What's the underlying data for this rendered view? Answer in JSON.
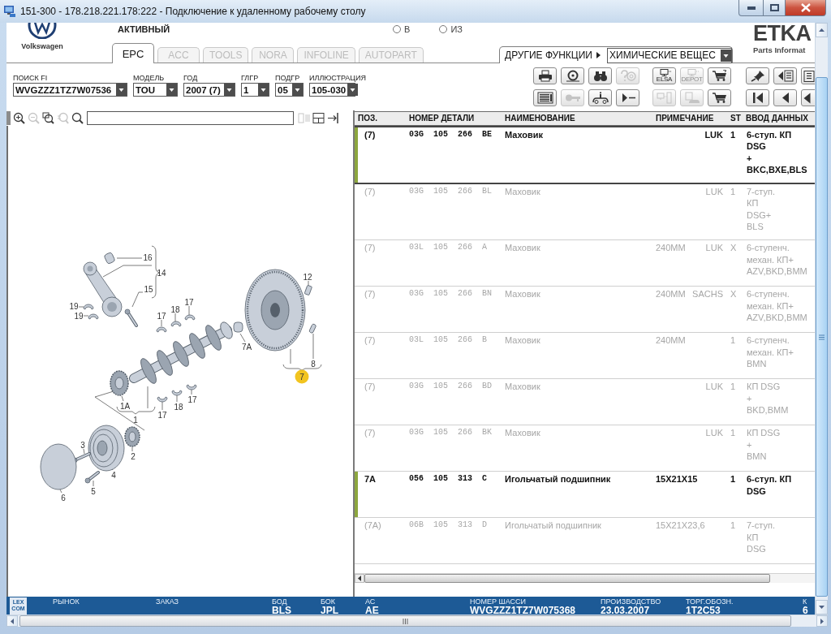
{
  "window": {
    "title": "151-300 - 178.218.221.178:222 - Подключение к удаленному рабочему столу"
  },
  "header": {
    "brand": "Volkswagen",
    "status": "АКТИВНЫЙ",
    "radios": [
      {
        "label": "В",
        "selected": false
      },
      {
        "label": "ИЗ",
        "selected": false
      }
    ],
    "logo": "ETKA",
    "logo_subtitle": "Parts Informat"
  },
  "tabs": [
    {
      "label": "EPC",
      "selected": true,
      "disabled": false
    },
    {
      "label": "ACC",
      "selected": false,
      "disabled": true
    },
    {
      "label": "TOOLS",
      "selected": false,
      "disabled": true
    },
    {
      "label": "NORA",
      "selected": false,
      "disabled": true
    },
    {
      "label": "INFOLINE",
      "selected": false,
      "disabled": true
    },
    {
      "label": "AUTOPART",
      "selected": false,
      "disabled": true
    }
  ],
  "other_functions": {
    "label": "ДРУГИЕ ФУНКЦИИ",
    "value": "ХИМИЧЕСКИЕ ВЕЩЕС"
  },
  "filters": [
    {
      "label": "ПОИСК FI",
      "value": "WVGZZZ1TZ7W07536"
    },
    {
      "label": "МОДЕЛЬ",
      "value": "TOU"
    },
    {
      "label": "ГОД",
      "value": "2007 (7)"
    },
    {
      "label": "ГЛГР",
      "value": "1"
    },
    {
      "label": "ПОДГР",
      "value": "05"
    },
    {
      "label": "ИЛЛЮСТРАЦИЯ",
      "value": "105-030"
    }
  ],
  "toolbar": {
    "rows": [
      [
        {
          "disabled": false
        },
        {
          "disabled": false
        },
        {
          "disabled": false
        },
        {
          "disabled": true
        },
        {
          "label": "ELSA",
          "disabled": false
        },
        {
          "label": "DEPOT",
          "disabled": true
        },
        {
          "disabled": false
        },
        {
          "disabled": false
        },
        {
          "disabled": false
        },
        {
          "disabled": false
        }
      ],
      [
        {
          "disabled": false
        },
        {
          "disabled": true
        },
        {
          "disabled": false
        },
        {
          "disabled": false
        },
        {
          "disabled": true
        },
        {
          "disabled": true
        },
        {
          "disabled": false
        },
        {
          "disabled": false
        },
        {
          "disabled": false
        },
        {
          "disabled": false
        }
      ]
    ]
  },
  "image_toolbar": {
    "buttons": [
      {
        "disabled": false
      },
      {
        "disabled": true
      },
      {
        "disabled": false
      },
      {
        "disabled": true
      },
      {
        "disabled": false
      },
      {
        "disabled": true
      },
      {
        "disabled": false
      },
      {
        "disabled": false
      }
    ]
  },
  "diagram": {
    "callouts": [
      {
        "label": "16",
        "selected": false
      },
      {
        "label": "14",
        "selected": false
      },
      {
        "label": "12",
        "selected": false
      },
      {
        "label": "15",
        "selected": false
      },
      {
        "label": "17",
        "selected": false
      },
      {
        "label": "19",
        "selected": false
      },
      {
        "label": "18",
        "selected": false
      },
      {
        "label": "19",
        "selected": false
      },
      {
        "label": "17",
        "selected": false
      },
      {
        "label": "7A",
        "selected": false
      },
      {
        "label": "8",
        "selected": false
      },
      {
        "label": "7",
        "selected": true
      },
      {
        "label": "17",
        "selected": false
      },
      {
        "label": "1A",
        "selected": false
      },
      {
        "label": "18",
        "selected": false
      },
      {
        "label": "17",
        "selected": false
      },
      {
        "label": "1",
        "selected": false
      },
      {
        "label": "3",
        "selected": false
      },
      {
        "label": "2",
        "selected": false
      },
      {
        "label": "4",
        "selected": false
      },
      {
        "label": "5",
        "selected": false
      },
      {
        "label": "6",
        "selected": false
      }
    ]
  },
  "table": {
    "columns": [
      "ПОЗ.",
      "НОМЕР ДЕТАЛИ",
      "НАИМЕНОВАНИЕ",
      "ПРИМЕЧАНИЕ",
      "ST",
      "ВВОД ДАННЫХ"
    ],
    "rows": [
      {
        "position": "(7)",
        "part_number": "03G 105 266 BE",
        "name": "Маховик",
        "manufacturer": "LUK",
        "st": "1",
        "data": "6-ступ. КП\nDSG\n+\nBKC,BXE,BLS",
        "applicable": true,
        "selected": true
      },
      {
        "position": "(7)",
        "part_number": "03G 105 266 BL",
        "name": "Маховик",
        "manufacturer": "LUK",
        "st": "1",
        "data": "7-ступ.\nКП\nDSG+\nBLS",
        "applicable": false,
        "selected": false
      },
      {
        "position": "(7)",
        "part_number": "03L 105 266 A",
        "name": "Маховик",
        "note": "240MM",
        "manufacturer": "LUK",
        "st": "X",
        "data": "6-ступенч.\nмехан. КП+\nAZV,BKD,BMM",
        "applicable": false,
        "selected": false
      },
      {
        "position": "(7)",
        "part_number": "03G 105 266 BN",
        "name": "Маховик",
        "note": "240MM",
        "manufacturer": "SACHS",
        "st": "X",
        "data": "6-ступенч.\nмехан. КП+\nAZV,BKD,BMM",
        "applicable": false,
        "selected": false
      },
      {
        "position": "(7)",
        "part_number": "03L 105 266 B",
        "name": "Маховик",
        "note": "240MM",
        "st": "1",
        "data": "6-ступенч.\nмехан. КП+\nBMN",
        "applicable": false,
        "selected": false
      },
      {
        "position": "(7)",
        "part_number": "03G 105 266 BD",
        "name": "Маховик",
        "manufacturer": "LUK",
        "st": "1",
        "data": "КП DSG\n+\nBKD,BMM",
        "applicable": false,
        "selected": false
      },
      {
        "position": "(7)",
        "part_number": "03G 105 266 BK",
        "name": "Маховик",
        "manufacturer": "LUK",
        "st": "1",
        "data": "КП DSG\n+\nBMN",
        "applicable": false,
        "selected": false
      },
      {
        "position": "7A",
        "part_number": "056 105 313 C",
        "name": "Игольчатый подшипник",
        "note": "15X21X15",
        "st": "1",
        "data": "6-ступ. КП\nDSG",
        "applicable": true,
        "selected": false
      },
      {
        "position": "(7A)",
        "part_number": "06B 105 313 D",
        "name": "Игольчатый подшипник",
        "note": "15X21X23,6",
        "st": "1",
        "data": "7-ступ.\nКП\nDSG",
        "applicable": false,
        "selected": false
      }
    ]
  },
  "status_bar": {
    "logo": "LEX COM",
    "fields": [
      {
        "label": "РЫНОК"
      },
      {
        "label": "ЗАКАЗ"
      },
      {
        "label": "БОД",
        "value": "BLS"
      },
      {
        "label": "БОК",
        "value": "JPL"
      },
      {
        "label": "АС",
        "value": "AE"
      },
      {
        "label": "НОМЕР ШАССИ",
        "value": "WVGZZZ1TZ7W075368"
      },
      {
        "label": "ПРОИЗВОДСТВО",
        "value": "23.03.2007"
      },
      {
        "label": "ТОРГ.ОБОЗН.",
        "value": "1T2C53"
      },
      {
        "label": "К",
        "value": "6"
      }
    ]
  }
}
